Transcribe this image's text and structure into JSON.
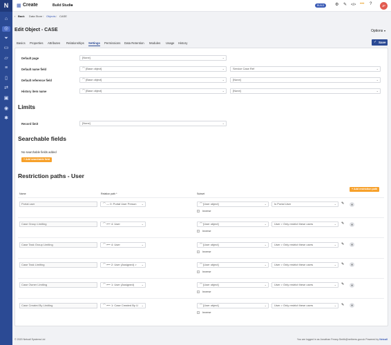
{
  "app": {
    "logo": "N",
    "title": "Create",
    "studio": "Build Studio",
    "build_badge": "BUILD",
    "avatar": "JF"
  },
  "icons": {
    "sidebar": [
      "home-icon",
      "settings-icon",
      "funnel-icon",
      "monitor-icon",
      "chat-icon",
      "layers-icon",
      "mobile-icon",
      "swap-icon",
      "lock-icon",
      "location-icon",
      "gear-icon"
    ]
  },
  "breadcrumb": {
    "back": "Back",
    "items": [
      "Data Store",
      "Objects",
      "CASE"
    ]
  },
  "page": {
    "title": "Edit Object - CASE",
    "options": "Options",
    "save": "Save"
  },
  "tabs": [
    "Basics",
    "Properties",
    "Attributes",
    "Relationships",
    "Settings",
    "Permissions",
    "Data Retention",
    "Modules",
    "Usage",
    "History"
  ],
  "active_tab": "Settings",
  "settings": {
    "default_page": {
      "label": "Default page",
      "value": "[None]"
    },
    "default_name": {
      "label": "Default name field",
      "value1": "[Base object]",
      "value2": "Service Case Ref"
    },
    "default_ref": {
      "label": "Default reference field",
      "value1": "[Base object]",
      "value2": "[None]"
    },
    "history": {
      "label": "History item name",
      "value1": "[Base object]",
      "value2": "[None]"
    }
  },
  "limits": {
    "heading": "Limits",
    "record_limit_label": "Record limit",
    "record_limit_value": "[None]"
  },
  "searchable": {
    "heading": "Searchable fields",
    "empty": "No searchable fields added",
    "add": "Add searchable field"
  },
  "restriction": {
    "heading": "Restriction paths - User",
    "add": "Add restriction path",
    "cols": {
      "name": "Name",
      "relation": "Relation path *",
      "subset": "Subset"
    },
    "inverse": "Inverse",
    "rows": [
      {
        "name": "Portal user",
        "relation": "0: Portal User Person",
        "subset": "[User object]",
        "subset2": "Is Portal User"
      },
      {
        "name": "Case Group Limiting",
        "relation": "4: User",
        "subset": "[User object]",
        "subset2": "User > Only restrict these users"
      },
      {
        "name": "Case Task Group Limiting",
        "relation": "4: User",
        "subset": "[User object]",
        "subset2": "User > Only restrict these users"
      },
      {
        "name": "Case Task Limiting",
        "relation": "2: User (Assigned) >",
        "subset": "[User object]",
        "subset2": "User > Only restrict these users"
      },
      {
        "name": "Case Owner Limiting",
        "relation": "1: User (Assigned)",
        "subset": "[User object]",
        "subset2": "User > Only restrict these users"
      },
      {
        "name": "Case Created By Limiting",
        "relation": "1: Case Created By U",
        "subset": "[User object]",
        "subset2": "User > Only restrict these users"
      }
    ]
  },
  "footer": {
    "left": "© 2020 Netcall Systems Ltd",
    "right_prefix": "You are logged in as Jonathan Freary-Smith@netherrs.gov.uk",
    "powered": "Powered by",
    "brand": "Netcall"
  }
}
